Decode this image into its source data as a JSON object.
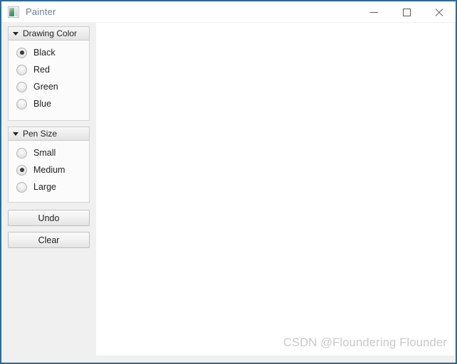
{
  "window": {
    "title": "Painter",
    "icon": "painter-app-icon",
    "border_color": "#36678c",
    "controls": [
      {
        "name": "minimize",
        "glyph": "minimize-icon"
      },
      {
        "name": "maximize",
        "glyph": "maximize-icon"
      },
      {
        "name": "close",
        "glyph": "close-icon"
      }
    ]
  },
  "sidebar": {
    "groups": [
      {
        "title": "Drawing Color",
        "collapsed": false,
        "options": [
          {
            "label": "Black",
            "checked": true
          },
          {
            "label": "Red",
            "checked": false
          },
          {
            "label": "Green",
            "checked": false
          },
          {
            "label": "Blue",
            "checked": false
          }
        ]
      },
      {
        "title": "Pen Size",
        "collapsed": false,
        "options": [
          {
            "label": "Small",
            "checked": false
          },
          {
            "label": "Medium",
            "checked": true
          },
          {
            "label": "Large",
            "checked": false
          }
        ]
      }
    ],
    "buttons": [
      {
        "label": "Undo"
      },
      {
        "label": "Clear"
      }
    ]
  },
  "canvas": {
    "background": "#ffffff",
    "watermark": "CSDN @Floundering Flounder"
  }
}
